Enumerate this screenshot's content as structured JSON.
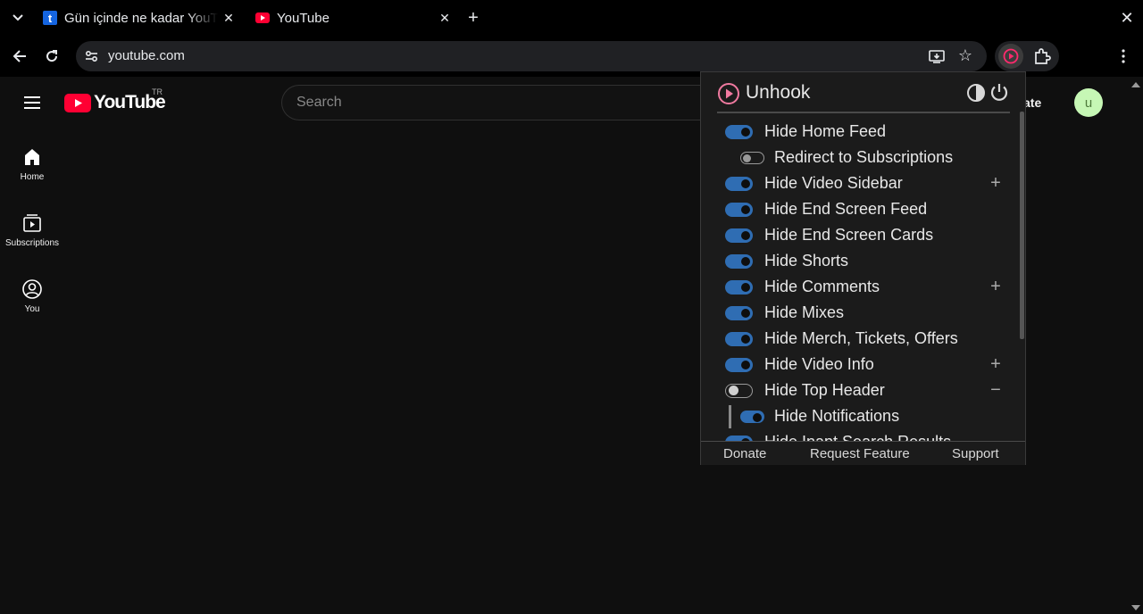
{
  "browser": {
    "tabs": [
      {
        "title": "Gün içinde ne kadar YouTube",
        "favicon": "tumblr-t-icon"
      },
      {
        "title": "YouTube",
        "favicon": "youtube-icon"
      }
    ],
    "url": "youtube.com"
  },
  "youtube": {
    "logo_text": "YouTube",
    "country_code": "TR",
    "search_placeholder": "Search",
    "create_label": "ate",
    "avatar_letter": "u",
    "nav": [
      {
        "label": "Home",
        "icon": "home-icon"
      },
      {
        "label": "Subscriptions",
        "icon": "subscriptions-icon"
      },
      {
        "label": "You",
        "icon": "you-icon"
      }
    ]
  },
  "unhook": {
    "title": "Unhook",
    "options": [
      {
        "label": "Hide Home Feed",
        "on": true
      },
      {
        "label": "Redirect to Subscriptions",
        "on": false,
        "sub": true
      },
      {
        "label": "Hide Video Sidebar",
        "on": true,
        "expand": "+"
      },
      {
        "label": "Hide End Screen Feed",
        "on": true
      },
      {
        "label": "Hide End Screen Cards",
        "on": true
      },
      {
        "label": "Hide Shorts",
        "on": true
      },
      {
        "label": "Hide Comments",
        "on": true,
        "expand": "+"
      },
      {
        "label": "Hide Mixes",
        "on": true
      },
      {
        "label": "Hide Merch, Tickets, Offers",
        "on": true
      },
      {
        "label": "Hide Video Info",
        "on": true,
        "expand": "+"
      },
      {
        "label": "Hide Top Header",
        "on": false,
        "expand": "−"
      },
      {
        "label": "Hide Notifications",
        "on": true,
        "sub": true
      },
      {
        "label": "Hide Inapt Search Results",
        "on": true
      }
    ],
    "footer": {
      "donate": "Donate",
      "request": "Request Feature",
      "support": "Support"
    }
  },
  "colors": {
    "toggle_on": "#2f6db3",
    "youtube_red": "#ff0033",
    "unhook_logo": "#f07aa0"
  }
}
